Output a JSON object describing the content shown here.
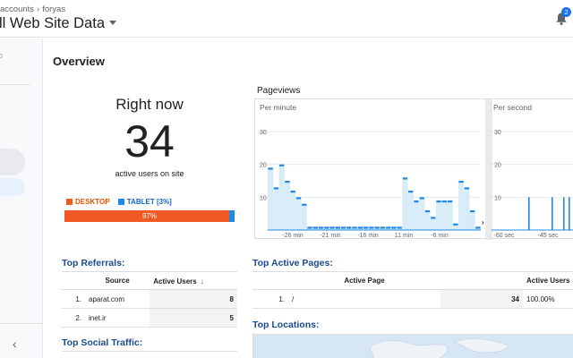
{
  "header": {
    "breadcrumb": [
      "accounts",
      "foryas"
    ],
    "view_title": "ll Web Site Data",
    "notification_count": "2"
  },
  "sidebar": {
    "partial_text": "o"
  },
  "overview": {
    "title": "Overview",
    "right_now": {
      "label": "Right now",
      "count": "34",
      "sublabel": "active users on site",
      "legend": [
        {
          "label": "DESKTOP",
          "color": "#f05a22"
        },
        {
          "label": "TABLET [3%]",
          "color": "#1e88e5"
        }
      ],
      "bar": {
        "desktop_percent": 97,
        "label": "97%"
      }
    }
  },
  "pageviews": {
    "title": "Pageviews",
    "per_minute_label": "Per minute",
    "per_second_label": "Per second",
    "expand_arrow": "›",
    "y_ticks": [
      "30",
      "20",
      "10"
    ],
    "sec_y_ticks": [
      "30",
      "20",
      "10"
    ],
    "min_x_labels": [
      "-26 min",
      "-21 min",
      "-16 min",
      "11 min",
      "-6 min"
    ],
    "sec_x_labels": [
      "-60 sec",
      "-45 sec"
    ],
    "colors": {
      "bar": "#1e88e5",
      "fill": "#d8ecf8",
      "grid": "#e8eaed"
    }
  },
  "top_referrals": {
    "title": "Top Referrals:",
    "columns": [
      "Source",
      "Active Users"
    ],
    "rows": [
      {
        "idx": "1.",
        "source": "aparat.com",
        "users": "8"
      },
      {
        "idx": "2.",
        "source": "inet.ir",
        "users": "5"
      }
    ]
  },
  "top_social": {
    "title": "Top Social Traffic:"
  },
  "top_active_pages": {
    "title": "Top Active Pages:",
    "columns": [
      "Active Page",
      "Active Users"
    ],
    "rows": [
      {
        "idx": "1.",
        "page": "/",
        "users": "34",
        "percent": "100.00%"
      }
    ]
  },
  "top_locations": {
    "title": "Top Locations:"
  },
  "chart_data": {
    "type": "bar",
    "title": "Pageviews",
    "subtitle": "Per minute",
    "xlabel": "",
    "ylabel": "",
    "ylim": [
      0,
      30
    ],
    "x_tick_labels": [
      "-26 min",
      "-21 min",
      "-16 min",
      "11 min",
      "-6 min"
    ],
    "values": [
      19,
      13,
      20,
      15,
      12,
      10,
      8,
      1,
      1,
      1,
      1,
      1,
      1,
      1,
      1,
      1,
      1,
      1,
      1,
      1,
      1,
      1,
      1,
      1,
      16,
      12,
      9,
      10,
      6,
      4,
      9,
      9,
      9,
      2,
      15,
      13,
      6,
      1
    ],
    "per_second": {
      "x_tick_labels": [
        "-60 sec",
        "-45 sec"
      ],
      "spikes": [
        10,
        10,
        10,
        10,
        10,
        10,
        10
      ]
    },
    "grid": true
  }
}
